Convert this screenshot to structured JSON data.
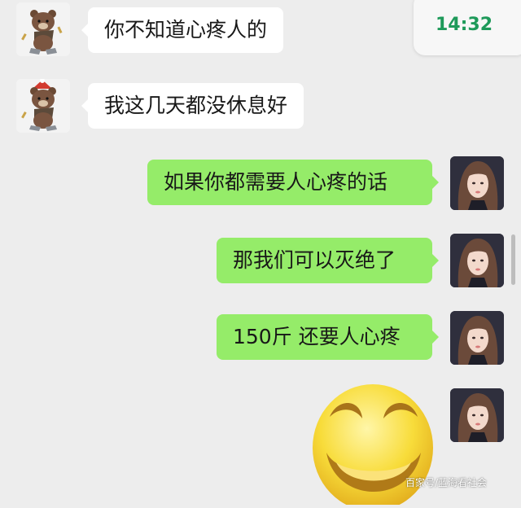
{
  "status": {
    "time": "14:32"
  },
  "messages": [
    {
      "side": "in",
      "avatar": "bear-avatar",
      "text": "你不知道心疼人的"
    },
    {
      "side": "in",
      "avatar": "bear-avatar",
      "text": "我这几天都没休息好"
    },
    {
      "side": "out",
      "avatar": "girl-avatar",
      "text": "如果你都需要人心疼的话"
    },
    {
      "side": "out",
      "avatar": "girl-avatar",
      "text": "那我们可以灭绝了"
    },
    {
      "side": "out",
      "avatar": "girl-avatar",
      "text": "150斤 还要人心疼"
    },
    {
      "side": "out",
      "avatar": "girl-avatar",
      "sticker": "grinning-face-sticker"
    }
  ],
  "watermark": "百家号/蓝海看社会",
  "colors": {
    "incoming_bubble": "#ffffff",
    "outgoing_bubble": "#95ec69",
    "background": "#ededed",
    "clock_green": "#1e9a5a"
  }
}
